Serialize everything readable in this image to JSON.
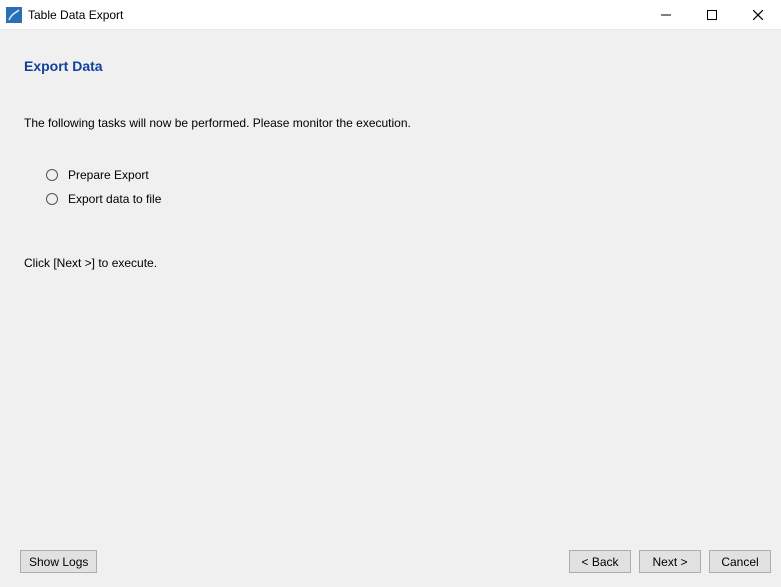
{
  "window": {
    "title": "Table Data Export"
  },
  "header": {
    "heading": "Export Data"
  },
  "body": {
    "description": "The following tasks will now be performed. Please monitor the execution.",
    "tasks": [
      {
        "label": "Prepare Export"
      },
      {
        "label": "Export data to file"
      }
    ],
    "instruction": "Click [Next >] to execute."
  },
  "footer": {
    "show_logs_label": "Show Logs",
    "back_label": "< Back",
    "next_label": "Next >",
    "cancel_label": "Cancel"
  }
}
